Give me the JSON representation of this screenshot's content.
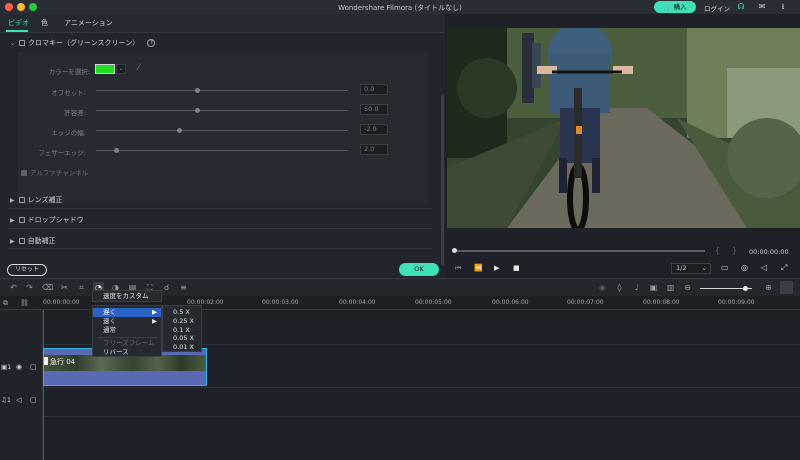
{
  "app": {
    "title": "Wondershare Filmora (タイトルなし)"
  },
  "topbar": {
    "buy_label": "購入",
    "login_label": "ログイン"
  },
  "tabs": [
    {
      "label": "ビデオ"
    },
    {
      "label": "色"
    },
    {
      "label": "アニメーション"
    }
  ],
  "chroma": {
    "title": "クロマキー（グリーンスクリーン）",
    "color_label": "カラーを選択:",
    "params": [
      {
        "label": "オフセット:",
        "value": "0.0",
        "level": 0.4
      },
      {
        "label": "許容差:",
        "value": "50.0",
        "level": 0.4
      },
      {
        "label": "エッジの幅:",
        "value": "-2.0",
        "level": 0.33
      },
      {
        "label": "フェザーエッジ:",
        "value": "2.0",
        "level": 0.08
      }
    ],
    "alpha_label": "アルファチャンネル",
    "key_color": "#22dd22"
  },
  "sections": [
    {
      "label": "レンズ補正"
    },
    {
      "label": "ドロップシャドウ"
    },
    {
      "label": "自動補正"
    }
  ],
  "buttons": {
    "reset": "リセット",
    "ok": "OK"
  },
  "preview": {
    "timecode": "00:00:00:00",
    "quality": "1/2"
  },
  "ruler": {
    "ticks": [
      "00:00:00:00",
      "00:00:02:00",
      "00:00:03:00",
      "00:00:04:00",
      "00:00:05:00",
      "00:00:06:00",
      "00:00:07:00",
      "00:00:08:00",
      "00:00:09:00"
    ]
  },
  "clip": {
    "name": "急行 04"
  },
  "tracks": {
    "video_index": "1",
    "audio_index": "1"
  },
  "speed_menu": {
    "custom": "速度をカスタム",
    "slow": "遅く",
    "fast": "速く",
    "normal": "通常",
    "freeze": "フリーズフレーム",
    "reverse": "リバース"
  },
  "speed_submenu": [
    "0.5 X",
    "0.25 X",
    "0.1 X",
    "0.05 X",
    "0.01 X"
  ],
  "colors": {
    "accent": "#3ee0b8",
    "clip_border": "#28b8e0",
    "clip_fill": "#5a69b3",
    "menu_highlight": "#2a63c8"
  }
}
